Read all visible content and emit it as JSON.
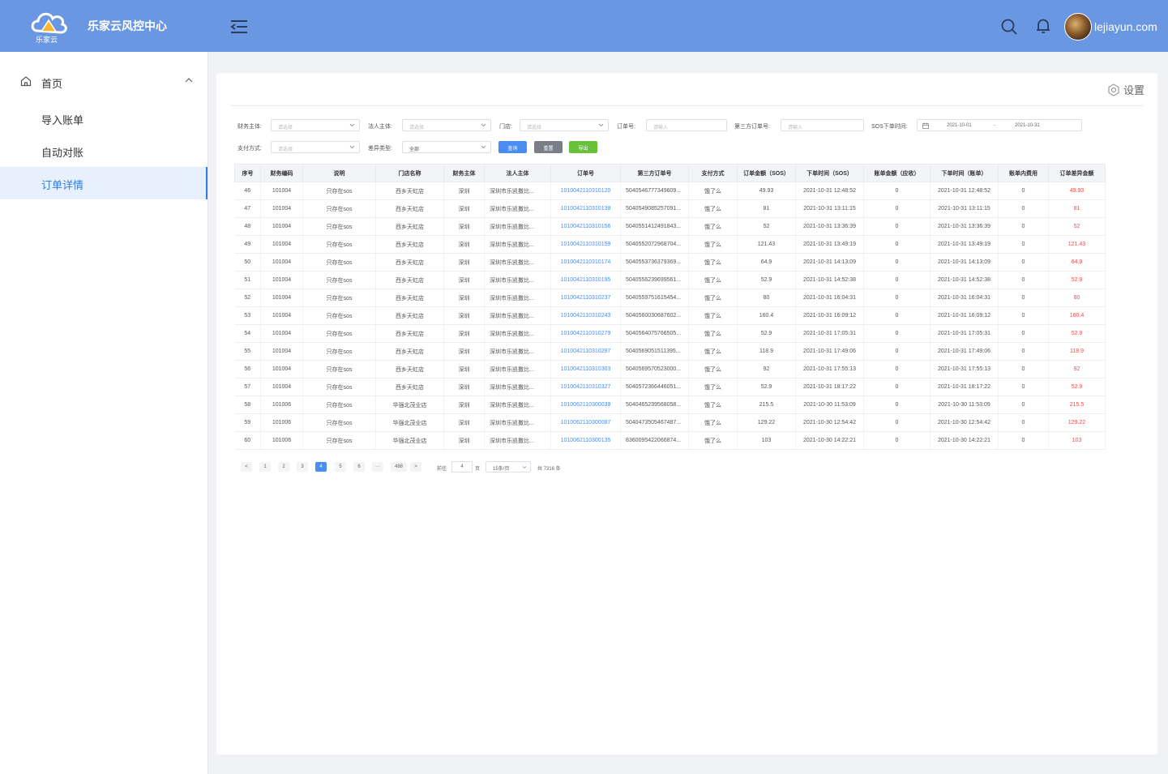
{
  "header": {
    "logo_text": "乐家云",
    "title": "乐家云风控中心",
    "username": "lejiayun.com"
  },
  "sidebar": {
    "root": {
      "label": "首页",
      "icon": "home-icon"
    },
    "items": [
      {
        "label": "导入账单",
        "active": false
      },
      {
        "label": "自动对账",
        "active": false
      },
      {
        "label": "订单详情",
        "active": true
      }
    ]
  },
  "main": {
    "settings_label": "设置",
    "filters": {
      "finance_entity": {
        "label": "财务主体:",
        "placeholder": "请选择"
      },
      "legal_entity": {
        "label": "法人主体:",
        "placeholder": "请选择"
      },
      "store": {
        "label": "门店:",
        "placeholder": "请选择"
      },
      "order_no": {
        "label": "订单号:",
        "placeholder": "请输入"
      },
      "third_order_no": {
        "label": "第三方订单号:",
        "placeholder": "请输入"
      },
      "sos_time": {
        "label": "SOS下单时间:",
        "start": "2021-10-01",
        "separator": "-",
        "end": "2021-10-31"
      },
      "pay_method": {
        "label": "支付方式:",
        "placeholder": "请选择"
      },
      "diff_type": {
        "label": "差异类型:",
        "value": "全部"
      }
    },
    "buttons": {
      "query": "查询",
      "reset": "重置",
      "export": "导出"
    },
    "colors": {
      "query": "#4a8df0",
      "reset": "#7a7f87",
      "export": "#67c23a",
      "accent": "#2f7de1",
      "header": "#6a97e2",
      "diff": "#f04b4b"
    },
    "columns": [
      "序号",
      "财务编码",
      "说明",
      "门店名称",
      "财务主体",
      "法人主体",
      "订单号",
      "第三方订单号",
      "支付方式",
      "订单金额（SOS）",
      "下单时间（SOS）",
      "账单金额（应收）",
      "下单时间（账单）",
      "账单内费用",
      "订单差异金额"
    ],
    "rows": [
      [
        "46",
        "101004",
        "只存在sos",
        "西乡天虹店",
        "深圳",
        "深圳市乐凯撒比...",
        "1010042110310120",
        "5040546777349609...",
        "饿了么",
        "49.93",
        "2021-10-31 12:48:52",
        "0",
        "2021-10-31 12:48:52",
        "0",
        "49.93"
      ],
      [
        "47",
        "101004",
        "只存在sos",
        "西乡天虹店",
        "深圳",
        "深圳市乐凯撒比...",
        "1010042110310138",
        "5040549085257091...",
        "饿了么",
        "81",
        "2021-10-31 13:11:15",
        "0",
        "2021-10-31 13:11:15",
        "0",
        "81"
      ],
      [
        "48",
        "101004",
        "只存在sos",
        "西乡天虹店",
        "深圳",
        "深圳市乐凯撒比...",
        "1010042110310156",
        "5040551412491843...",
        "饿了么",
        "52",
        "2021-10-31 13:36:39",
        "0",
        "2021-10-31 13:36:39",
        "0",
        "52"
      ],
      [
        "49",
        "101004",
        "只存在sos",
        "西乡天虹店",
        "深圳",
        "深圳市乐凯撒比...",
        "1010042110310159",
        "5040552072968704...",
        "饿了么",
        "121.43",
        "2021-10-31 13:49:19",
        "0",
        "2021-10-31 13:49:19",
        "0",
        "121.43"
      ],
      [
        "50",
        "101004",
        "只存在sos",
        "西乡天虹店",
        "深圳",
        "深圳市乐凯撒比...",
        "1010042110310174",
        "5040553736379369...",
        "饿了么",
        "64.9",
        "2021-10-31 14:13:09",
        "0",
        "2021-10-31 14:13:09",
        "0",
        "64.9"
      ],
      [
        "51",
        "101004",
        "只存在sos",
        "西乡天虹店",
        "深圳",
        "深圳市乐凯撒比...",
        "1010042110310195",
        "5040556239699561...",
        "饿了么",
        "52.9",
        "2021-10-31 14:52:38",
        "0",
        "2021-10-31 14:52:38",
        "0",
        "52.9"
      ],
      [
        "52",
        "101004",
        "只存在sos",
        "西乡天虹店",
        "深圳",
        "深圳市乐凯撒比...",
        "1010042110310237",
        "5040559751615454...",
        "饿了么",
        "80",
        "2021-10-31 16:04:31",
        "0",
        "2021-10-31 16:04:31",
        "0",
        "80"
      ],
      [
        "53",
        "101004",
        "只存在sos",
        "西乡天虹店",
        "深圳",
        "深圳市乐凯撒比...",
        "1010042110310243",
        "5040560030687602...",
        "饿了么",
        "160.4",
        "2021-10-31 16:09:12",
        "0",
        "2021-10-31 16:09:12",
        "0",
        "160.4"
      ],
      [
        "54",
        "101004",
        "只存在sos",
        "西乡天虹店",
        "深圳",
        "深圳市乐凯撒比...",
        "1010042110310279",
        "5040564075766505...",
        "饿了么",
        "52.9",
        "2021-10-31 17:05:31",
        "0",
        "2021-10-31 17:05:31",
        "0",
        "52.9"
      ],
      [
        "55",
        "101004",
        "只存在sos",
        "西乡天虹店",
        "深圳",
        "深圳市乐凯撒比...",
        "1010042110310297",
        "5040569051511395...",
        "饿了么",
        "118.9",
        "2021-10-31 17:49:06",
        "0",
        "2021-10-31 17:49:06",
        "0",
        "118.9"
      ],
      [
        "56",
        "101004",
        "只存在sos",
        "西乡天虹店",
        "深圳",
        "深圳市乐凯撒比...",
        "1010042110310303",
        "5040569570523000...",
        "饿了么",
        "92",
        "2021-10-31 17:55:13",
        "0",
        "2021-10-31 17:55:13",
        "0",
        "92"
      ],
      [
        "57",
        "101004",
        "只存在sos",
        "西乡天虹店",
        "深圳",
        "深圳市乐凯撒比...",
        "1010042110310327",
        "5040572366446051...",
        "饿了么",
        "52.9",
        "2021-10-31 18:17:22",
        "0",
        "2021-10-31 18:17:22",
        "0",
        "52.9"
      ],
      [
        "58",
        "101006",
        "只存在sos",
        "华强北茂业店",
        "深圳",
        "深圳市乐凯撒比...",
        "1010062110300039",
        "5040465239568058...",
        "饿了么",
        "215.5",
        "2021-10-30 11:53:09",
        "0",
        "2021-10-30 11:53:09",
        "0",
        "215.5"
      ],
      [
        "59",
        "101006",
        "只存在sos",
        "华强北茂业店",
        "深圳",
        "深圳市乐凯撒比...",
        "1010062110300087",
        "5040473505467487...",
        "饿了么",
        "129.22",
        "2021-10-30 12:54:42",
        "0",
        "2021-10-30 12:54:42",
        "0",
        "129.22"
      ],
      [
        "60",
        "101006",
        "只存在sos",
        "华强北茂业店",
        "深圳",
        "深圳市乐凯撒比...",
        "1010062110300135",
        "8360095422066874...",
        "饿了么",
        "103",
        "2021-10-30 14:22:21",
        "0",
        "2021-10-30 14:22:21",
        "0",
        "103"
      ]
    ],
    "pagination": {
      "prev": "<",
      "pages": [
        "1",
        "2",
        "3",
        "4",
        "5",
        "6",
        "···",
        "488"
      ],
      "current": "4",
      "next": ">",
      "goto_prefix": "前往",
      "goto_value": "4",
      "goto_suffix": "页",
      "page_size": "15条/页",
      "total": "共 7316 条"
    }
  }
}
